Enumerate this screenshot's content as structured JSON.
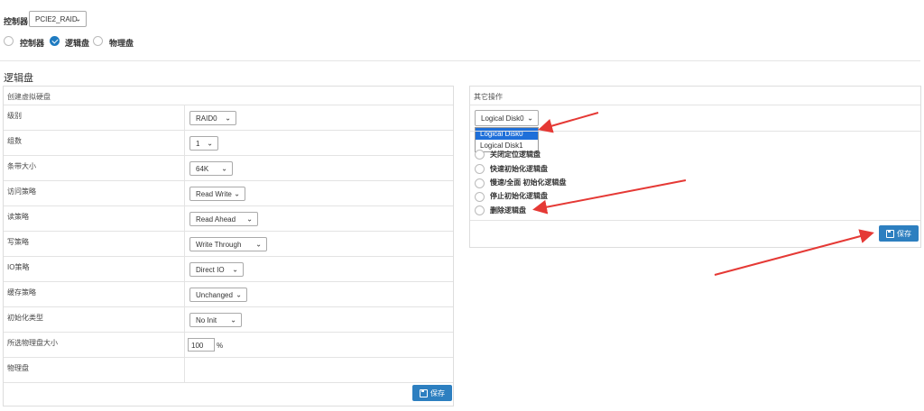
{
  "top": {
    "controller_label": "控制器",
    "controller_select": "PCIE2_RAID",
    "radios": [
      {
        "label": "控制器",
        "checked": false
      },
      {
        "label": "逻辑盘",
        "checked": true
      },
      {
        "label": "物理盘",
        "checked": false
      }
    ]
  },
  "section_title": "逻辑盘",
  "create_panel": {
    "title": "创建虚拟硬盘",
    "rows": [
      {
        "label": "级别",
        "value": "RAID0"
      },
      {
        "label": "组数",
        "value": "1"
      },
      {
        "label": "条带大小",
        "value": "64K"
      },
      {
        "label": "访问策略",
        "value": "Read Write"
      },
      {
        "label": "读策略",
        "value": "Read Ahead"
      },
      {
        "label": "写策略",
        "value": "Write Through"
      },
      {
        "label": "IO策略",
        "value": "Direct IO"
      },
      {
        "label": "缓存策略",
        "value": "Unchanged"
      },
      {
        "label": "初始化类型",
        "value": "No Init"
      },
      {
        "label": "所选物理盘大小",
        "value": "100",
        "unit": "%"
      },
      {
        "label": "物理盘",
        "value": ""
      }
    ],
    "save_label": "保存"
  },
  "other_panel": {
    "title": "其它操作",
    "disk_select": "Logical Disk0",
    "dropdown_options": [
      "Logical Disk0",
      "Logical Disk1"
    ],
    "operations": [
      "关闭定位逻辑盘",
      "快速初始化逻辑盘",
      "慢速/全面 初始化逻辑盘",
      "停止初始化逻辑盘",
      "删除逻辑盘"
    ],
    "save_label": "保存"
  },
  "colors": {
    "accent": "#2d7fc0",
    "arrow": "#e53935"
  }
}
